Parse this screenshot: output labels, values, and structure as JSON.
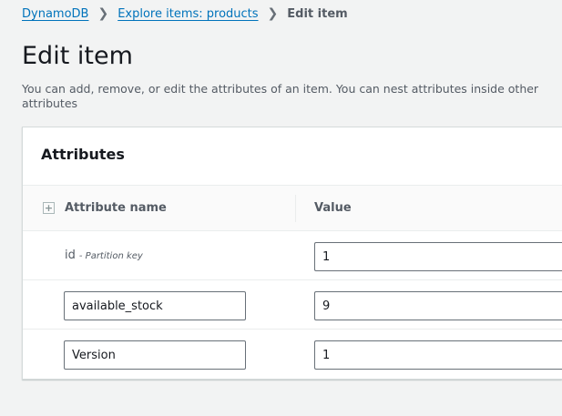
{
  "breadcrumb": [
    {
      "label": "DynamoDB"
    },
    {
      "label": "Explore items: products"
    },
    {
      "label": "Edit item"
    }
  ],
  "page": {
    "title": "Edit item",
    "description": "You can add, remove, or edit the attributes of an item. You can nest attributes inside other attributes"
  },
  "card": {
    "title": "Attributes",
    "columns": [
      "Attribute name",
      "Value"
    ],
    "rows": [
      {
        "name": "id",
        "key_label": "- Partition key",
        "value": "1"
      },
      {
        "name": "available_stock",
        "value": "9"
      },
      {
        "name": "Version",
        "value": "1"
      }
    ]
  },
  "colors": {
    "link": "#0073bb",
    "background": "#f2f3f3"
  }
}
